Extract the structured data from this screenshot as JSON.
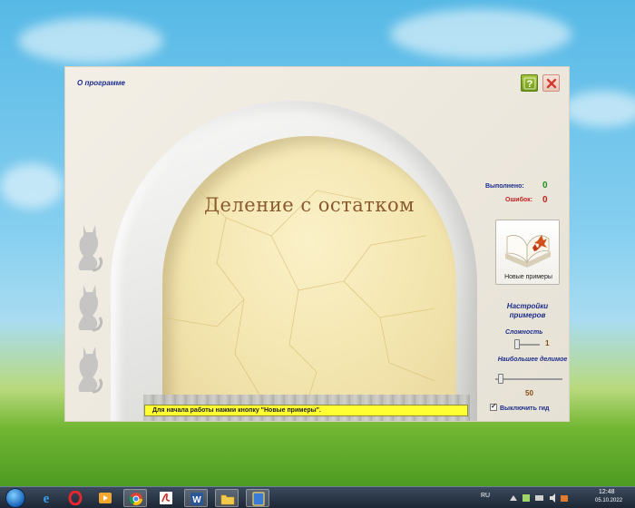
{
  "app": {
    "about_link": "О программе",
    "title": "Деление с остатком",
    "status_message": "Для начала работы нажми кнопку \"Новые примеры\".",
    "stats": {
      "done_label": "Выполнено:",
      "done_value": "0",
      "errors_label": "Ошибок:",
      "errors_value": "0"
    },
    "new_examples_label": "Новые примеры",
    "settings": {
      "title": "Настройки примеров",
      "difficulty_label": "Сложность",
      "difficulty_value": "1",
      "max_dividend_label": "Наибольшее делимое",
      "max_dividend_value": "50",
      "difficulty_level": 0.0,
      "max_dividend_level": 0.05
    },
    "guide_toggle_label": "Выключить гид",
    "guide_toggle_checked": true
  },
  "taskbar": {
    "language": "RU",
    "time": "12:48",
    "date": "05.10.2022"
  },
  "colors": {
    "accent_blue": "#1c2c8c",
    "title_brown": "#8a5a2e",
    "status_yellow": "#ffff33",
    "done_green": "#1f8f1f",
    "error_red": "#c01f1f"
  },
  "icons": [
    "help-icon",
    "close-icon",
    "book-icon",
    "cat-icon",
    "windows-start-icon",
    "ie-icon",
    "opera-icon",
    "media-player-icon",
    "chrome-icon",
    "acrobat-icon",
    "word-icon",
    "explorer-icon",
    "app-icon"
  ]
}
